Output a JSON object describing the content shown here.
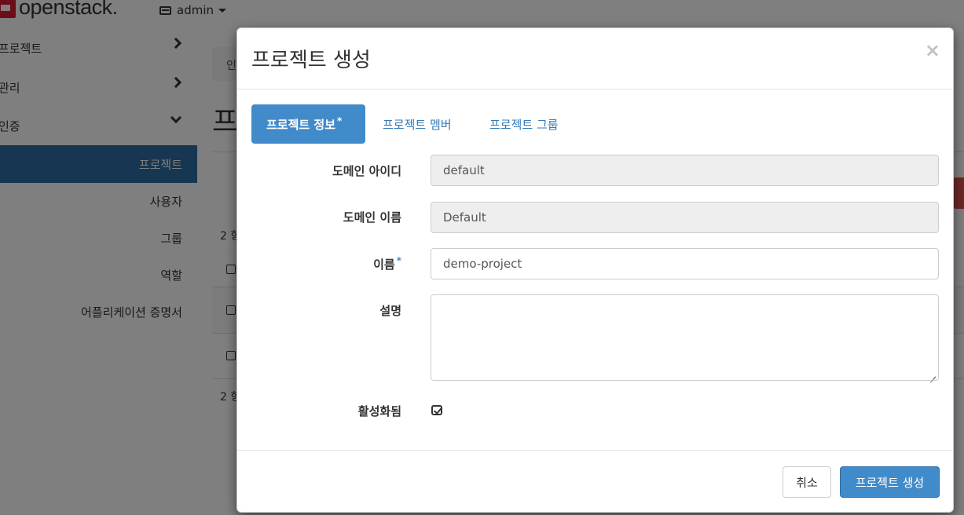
{
  "header": {
    "brand": "openstack.",
    "user_menu": "admin"
  },
  "sidebar": {
    "sections": [
      {
        "label": "프로젝트"
      },
      {
        "label": "관리"
      },
      {
        "label": "인증"
      }
    ],
    "items": [
      {
        "label": "프로젝트"
      },
      {
        "label": "사용자"
      },
      {
        "label": "그룹"
      },
      {
        "label": "역할"
      },
      {
        "label": "어플리케이션 증명서"
      }
    ]
  },
  "background": {
    "breadcrumb": "인",
    "page_title": "프",
    "count_top": "2 항",
    "count_bottom": "2 항"
  },
  "modal": {
    "title": "프로젝트 생성",
    "close": "×",
    "tabs": [
      {
        "label": "프로젝트 정보",
        "required": "*"
      },
      {
        "label": "프로젝트 멤버"
      },
      {
        "label": "프로젝트 그룹"
      }
    ],
    "fields": {
      "domain_id": {
        "label": "도메인 아이디",
        "value": "default"
      },
      "domain_name": {
        "label": "도메인 이름",
        "value": "Default"
      },
      "name": {
        "label": "이름",
        "required": "*",
        "value": "demo-project"
      },
      "description": {
        "label": "설명",
        "value": ""
      },
      "enabled": {
        "label": "활성화됨",
        "checked": true
      }
    },
    "buttons": {
      "cancel": "취소",
      "submit": "프로젝트 생성"
    }
  },
  "colors": {
    "primary": "#428bca",
    "active_nav": "#2e6da4",
    "brand_red": "#da1a32"
  }
}
